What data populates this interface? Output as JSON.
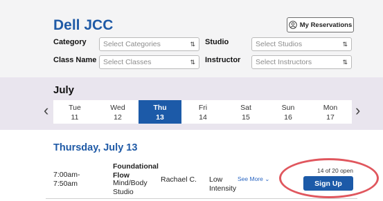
{
  "header": {
    "title": "Dell JCC",
    "reservations_label": "My Reservations"
  },
  "filters": {
    "category_label": "Category",
    "category_placeholder": "Select Categories",
    "studio_label": "Studio",
    "studio_placeholder": "Select Studios",
    "classname_label": "Class Name",
    "classname_placeholder": "Select Classes",
    "instructor_label": "Instructor",
    "instructor_placeholder": "Select Instructors",
    "dropdown_arrows": "⇅"
  },
  "calendar": {
    "month": "July",
    "prev": "‹",
    "next": "›",
    "days": [
      {
        "day": "Tue",
        "date": "11"
      },
      {
        "day": "Wed",
        "date": "12"
      },
      {
        "day": "Thu",
        "date": "13"
      },
      {
        "day": "Fri",
        "date": "14"
      },
      {
        "day": "Sat",
        "date": "15"
      },
      {
        "day": "Sun",
        "date": "16"
      },
      {
        "day": "Mon",
        "date": "17"
      }
    ],
    "selected_index": 2
  },
  "schedule": {
    "date_heading": "Thursday, July 13",
    "class": {
      "time_start": "7:00am-",
      "time_end": "7:50am",
      "name_line1": "Foundational",
      "name_line2": "Flow",
      "category_line1": "Mind/Body",
      "category_line2": "Studio",
      "instructor": "Rachael C.",
      "intensity_line1": "Low",
      "intensity_line2": "Intensity",
      "see_more": "See More ⌄",
      "open_count": "14 of 20 open",
      "signup_label": "Sign Up"
    }
  },
  "colors": {
    "brand_blue": "#1f5aa6",
    "selected_day": "#1c5aa8",
    "highlight_circle": "#e0575e",
    "filter_bg": "#f4f4f5",
    "week_bg": "#e9e5ee"
  },
  "icons": {
    "reservations": "user-circle-icon"
  }
}
